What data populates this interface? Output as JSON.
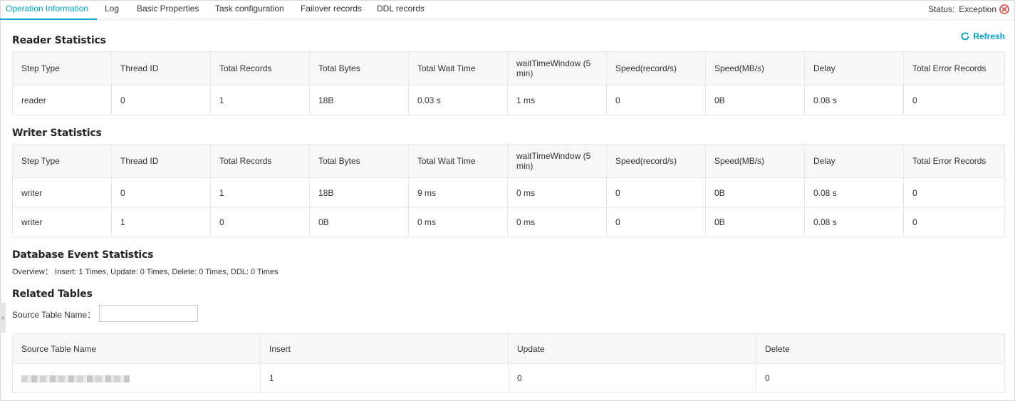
{
  "tabs": [
    {
      "label": "Operation Information",
      "active": true
    },
    {
      "label": "Log",
      "active": false
    },
    {
      "label": "Basic Properties",
      "active": false
    },
    {
      "label": "Task configuration",
      "active": false
    },
    {
      "label": "Failover records",
      "active": false
    },
    {
      "label": "DDL records",
      "active": false
    }
  ],
  "status": {
    "label": "Status:",
    "value": "Exception",
    "icon": "error-circle-icon",
    "color": "#e5433a"
  },
  "refresh": {
    "label": "Refresh",
    "icon": "refresh-icon"
  },
  "accent_color": "#00a2ca",
  "reader": {
    "title": "Reader Statistics",
    "columns": [
      "Step Type",
      "Thread ID",
      "Total Records",
      "Total Bytes",
      "Total Wait Time",
      "waitTimeWindow (5 min)",
      "Speed(record/s)",
      "Speed(MB/s)",
      "Delay",
      "Total Error Records"
    ],
    "rows": [
      [
        "reader",
        "0",
        "1",
        "18B",
        "0.03 s",
        "1 ms",
        "0",
        "0B",
        "0.08 s",
        "0"
      ]
    ]
  },
  "writer": {
    "title": "Writer Statistics",
    "columns": [
      "Step Type",
      "Thread ID",
      "Total Records",
      "Total Bytes",
      "Total Wait Time",
      "waitTimeWindow (5 min)",
      "Speed(record/s)",
      "Speed(MB/s)",
      "Delay",
      "Total Error Records"
    ],
    "rows": [
      [
        "writer",
        "0",
        "1",
        "18B",
        "9 ms",
        "0 ms",
        "0",
        "0B",
        "0.08 s",
        "0"
      ],
      [
        "writer",
        "1",
        "0",
        "0B",
        "0 ms",
        "0 ms",
        "0",
        "0B",
        "0.08 s",
        "0"
      ]
    ]
  },
  "db_events": {
    "title": "Database Event Statistics",
    "overview": "Overview： Insert: 1 Times, Update: 0 Times, Delete: 0 Times, DDL: 0 Times"
  },
  "related": {
    "title": "Related Tables",
    "filter_label": "Source Table Name：",
    "filter_value": "",
    "columns": [
      "Source Table Name",
      "Insert",
      "Update",
      "Delete"
    ],
    "rows": [
      {
        "insert": "1",
        "update": "0",
        "delete": "0"
      }
    ]
  },
  "side_handle": "»"
}
